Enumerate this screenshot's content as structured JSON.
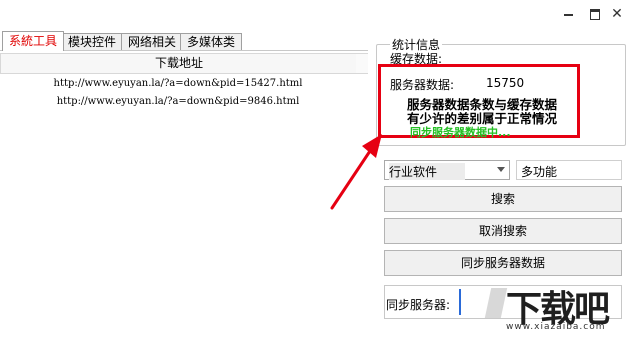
{
  "window": {
    "min": "minimize",
    "max": "maximize",
    "close": "✕"
  },
  "tabs": [
    {
      "label": "系統工具",
      "active": true
    },
    {
      "label": "模块控件",
      "active": false
    },
    {
      "label": "网络相关",
      "active": false
    },
    {
      "label": "多媒体类",
      "active": false
    }
  ],
  "list": {
    "header": "下载地址",
    "rows": [
      "http://www.eyuyan.la/?a=down&pid=15427.html",
      "http://www.eyuyan.la/?a=down&pid=9846.html"
    ]
  },
  "stats": {
    "title": "统计信息",
    "cache_label": "缓存数据:",
    "server_label": "服务器数据:",
    "server_count": "15750",
    "warning_line1": "服务器数据条数与缓存数据",
    "warning_line2": "有少许的差别属于正常情况",
    "sync_status": "同步服务器数据中...",
    "highlight_color": "#e60012",
    "status_color": "#24c024"
  },
  "controls": {
    "category_selected": "行业软件",
    "keyword_value": "多功能",
    "search_button": "搜索",
    "cancel_search_button": "取消搜索",
    "sync_data_button": "同步服务器数据",
    "sync_server_label": "同步服务器:"
  },
  "watermark": {
    "brand": "下载吧",
    "url": "www.xiazaiba.com"
  },
  "annotation": {
    "arrow_color": "#e60012"
  }
}
